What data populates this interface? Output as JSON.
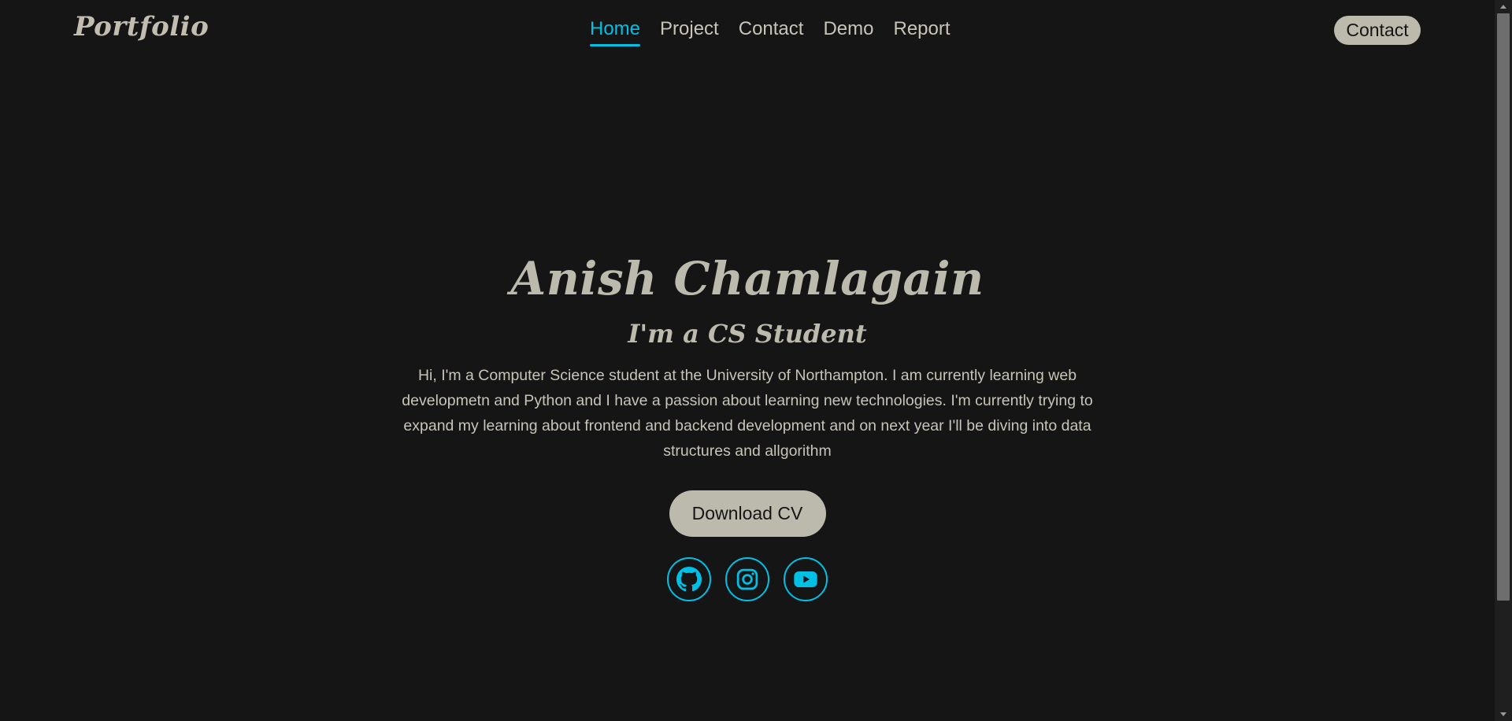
{
  "header": {
    "logo": "Portfolio",
    "nav": [
      {
        "label": "Home",
        "active": true
      },
      {
        "label": "Project",
        "active": false
      },
      {
        "label": "Contact",
        "active": false
      },
      {
        "label": "Demo",
        "active": false
      },
      {
        "label": "Report",
        "active": false
      }
    ],
    "contact_button": "Contact"
  },
  "hero": {
    "name": "Anish Chamlagain",
    "subtitle": "I'm a CS Student",
    "bio": "Hi, I'm a Computer Science student at the University of Northampton. I am currently learning web developmetn and Python and I have a passion about learning new technologies. I'm currently trying to expand my learning about frontend and backend development and on next year I'll be diving into data structures and allgorithm",
    "cv_button": "Download CV",
    "socials": [
      {
        "icon": "github-icon"
      },
      {
        "icon": "instagram-icon"
      },
      {
        "icon": "youtube-icon"
      }
    ]
  },
  "colors": {
    "background": "#151515",
    "accent": "#00c0e6",
    "text": "#c8c4b8",
    "button_bg": "#bcb9ad"
  }
}
